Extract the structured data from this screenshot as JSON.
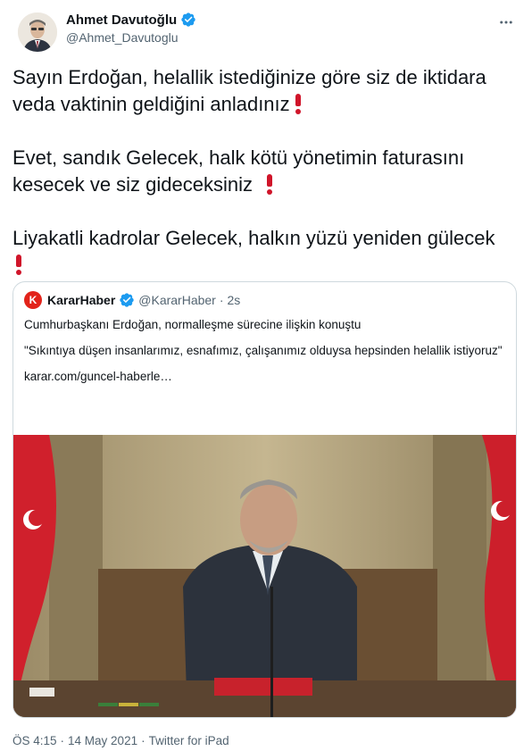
{
  "author": {
    "display_name": "Ahmet Davutoğlu",
    "handle": "@Ahmet_Davutoglu",
    "verified_icon": "verified-badge-icon",
    "more_icon": "more-options-icon"
  },
  "tweet": {
    "paragraphs": [
      "Sayın Erdoğan, helallik istediğinize göre siz de iktidara veda vaktinin geldiğini anladınız",
      "Evet, sandık Gelecek, halk kötü yönetimin faturasını kesecek ve siz gideceksiniz",
      "Liyakatli kadrolar Gelecek, halkın yüzü yeniden gülecek"
    ],
    "emoji_icon": "red-exclamation-icon"
  },
  "quoted": {
    "logo_letter": "K",
    "name": "KararHaber",
    "handle": "@KararHaber",
    "dot": "·",
    "time": "2s",
    "text1": "Cumhurbaşkanı Erdoğan, normalleşme sürecine ilişkin konuştu",
    "text2": "\"Sıkıntıya düşen insanlarımız, esnafımız, çalışanımız olduysa hepsinden helallik istiyoruz\"",
    "link": "karar.com/guncel-haberle…",
    "image_icon": "press-conference-photo"
  },
  "meta": {
    "time": "ÖS 4:15",
    "dot1": "·",
    "date": "14 May 2021",
    "dot2": "·",
    "source": "Twitter for iPad"
  },
  "colors": {
    "verified": "#1d9bf0",
    "text": "#0f1419",
    "secondary": "#536471",
    "emoji_red": "#d0152a",
    "border": "#cfd9de"
  }
}
